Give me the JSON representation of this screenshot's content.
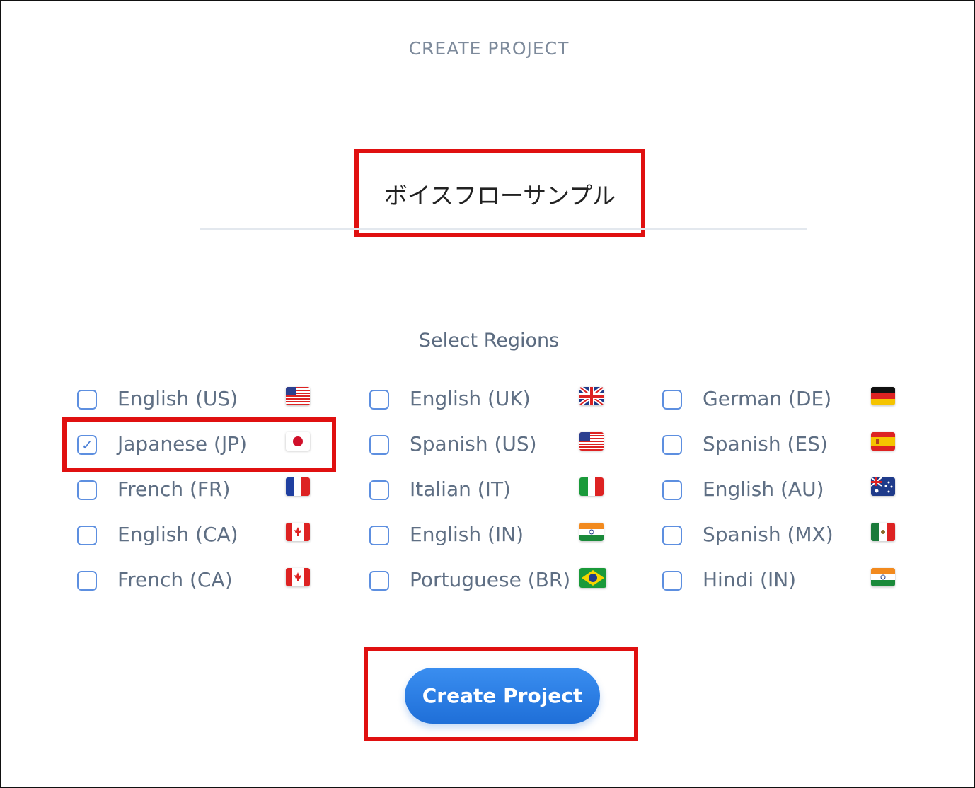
{
  "header": {
    "title": "CREATE PROJECT"
  },
  "project": {
    "name": "ボイスフローサンプル"
  },
  "regions": {
    "label": "Select Regions",
    "items": [
      {
        "label": "English (US)",
        "flag": "us-flag",
        "checked": false
      },
      {
        "label": "English (UK)",
        "flag": "uk-flag",
        "checked": false
      },
      {
        "label": "German (DE)",
        "flag": "de-flag",
        "checked": false
      },
      {
        "label": "Japanese (JP)",
        "flag": "jp-flag",
        "checked": true
      },
      {
        "label": "Spanish (US)",
        "flag": "us-flag",
        "checked": false
      },
      {
        "label": "Spanish (ES)",
        "flag": "es-flag",
        "checked": false
      },
      {
        "label": "French (FR)",
        "flag": "fr-flag",
        "checked": false
      },
      {
        "label": "Italian (IT)",
        "flag": "it-flag",
        "checked": false
      },
      {
        "label": "English (AU)",
        "flag": "au-flag",
        "checked": false
      },
      {
        "label": "English (CA)",
        "flag": "ca-flag",
        "checked": false
      },
      {
        "label": "English (IN)",
        "flag": "in-flag",
        "checked": false
      },
      {
        "label": "Spanish (MX)",
        "flag": "mx-flag",
        "checked": false
      },
      {
        "label": "French (CA)",
        "flag": "ca-flag",
        "checked": false
      },
      {
        "label": "Portuguese (BR)",
        "flag": "br-flag",
        "checked": false
      },
      {
        "label": "Hindi (IN)",
        "flag": "in-flag",
        "checked": false
      }
    ]
  },
  "actions": {
    "create_label": "Create Project"
  },
  "colors": {
    "accent": "#2a7de6",
    "highlight": "#e01010"
  }
}
